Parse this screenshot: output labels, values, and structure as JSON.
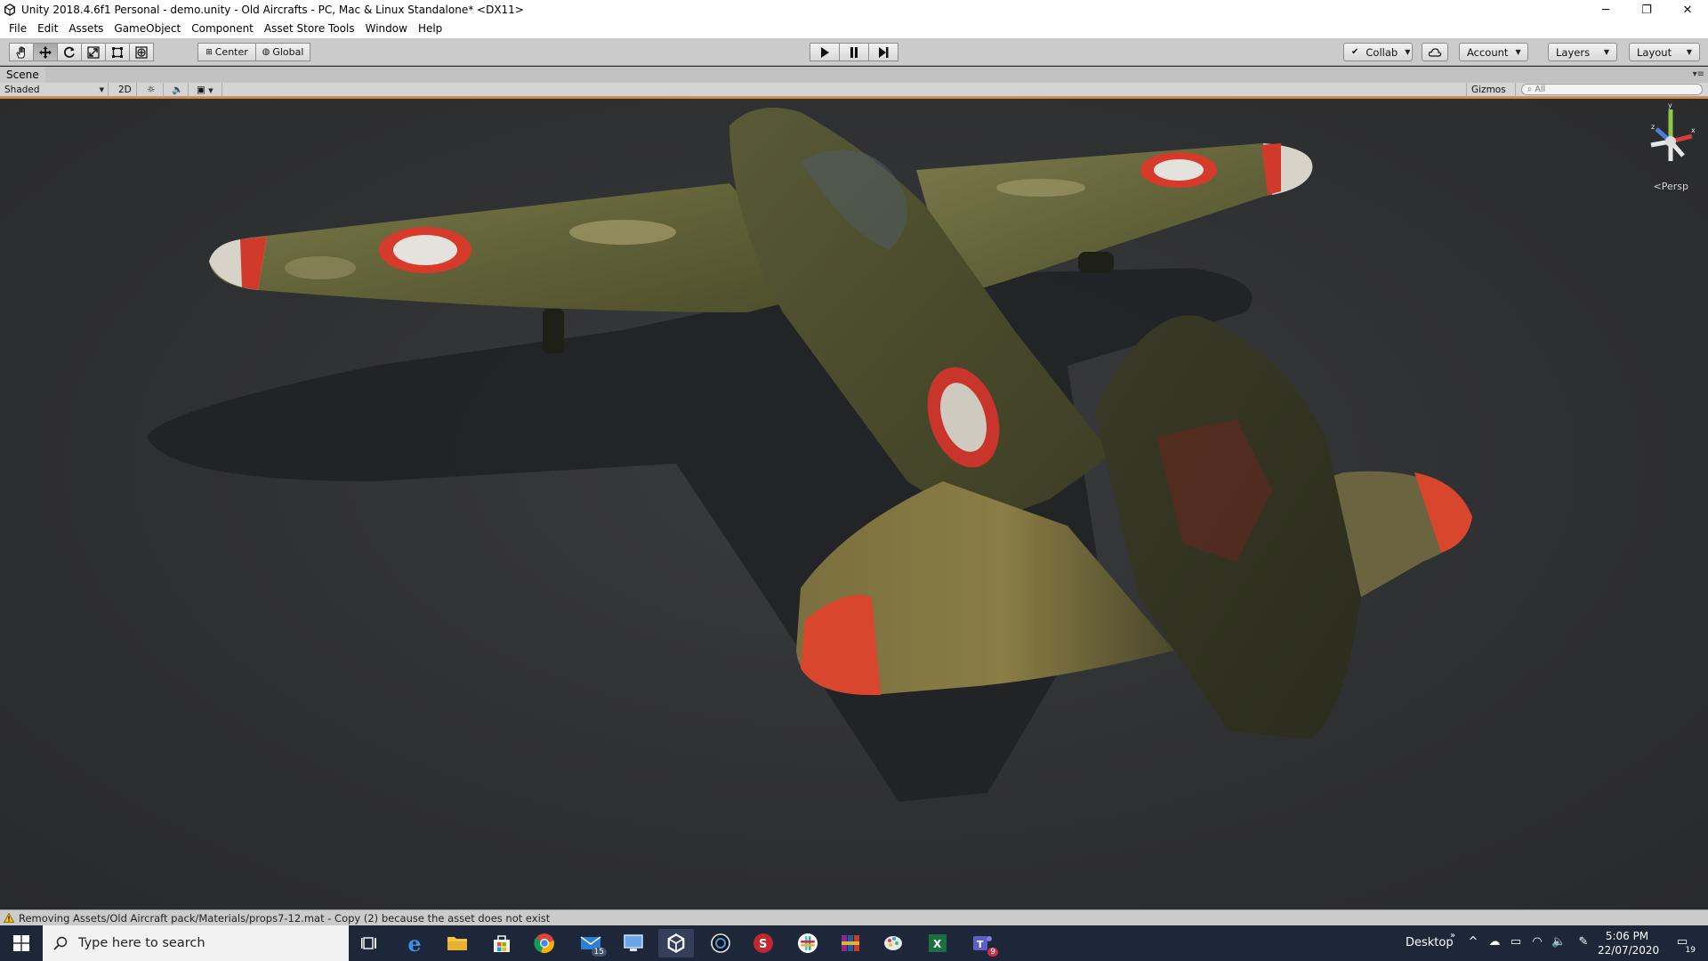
{
  "window": {
    "title": "Unity 2018.4.6f1 Personal - demo.unity - Old Aircrafts - PC, Mac & Linux Standalone* <DX11>",
    "controls": {
      "minimize": "─",
      "restore": "❐",
      "close": "✕"
    }
  },
  "menu": [
    "File",
    "Edit",
    "Assets",
    "GameObject",
    "Component",
    "Asset Store Tools",
    "Window",
    "Help"
  ],
  "toolbar": {
    "transform_tools": [
      {
        "name": "hand-tool",
        "icon": "hand-icon"
      },
      {
        "name": "move-tool",
        "icon": "move-icon"
      },
      {
        "name": "rotate-tool",
        "icon": "rotate-icon"
      },
      {
        "name": "scale-tool",
        "icon": "scale-icon"
      },
      {
        "name": "rect-tool",
        "icon": "rect-icon"
      },
      {
        "name": "transform-tool",
        "icon": "transform-icon"
      }
    ],
    "pivot_label": "Center",
    "space_label": "Global",
    "collab_label": "Collab",
    "account_label": "Account",
    "layers_label": "Layers",
    "layout_label": "Layout"
  },
  "scene": {
    "tab_label": "Scene",
    "shading_mode": "Shaded",
    "mode_2d": "2D",
    "gizmos_label": "Gizmos",
    "search_placeholder": "All",
    "persp_label": "Persp",
    "gizmo_axes": {
      "y": "y",
      "z": "z",
      "x": "x"
    }
  },
  "status": {
    "message": "Removing Assets/Old Aircraft pack/Materials/props7-12.mat - Copy (2) because the asset does not exist"
  },
  "taskbar": {
    "search_placeholder": "Type here to search",
    "mail_badge": "15",
    "teams_badge": "9",
    "desktop_label": "Desktop",
    "time": "5:06 PM",
    "date": "22/07/2020",
    "notification_count": "19"
  },
  "colors": {
    "accent_orange": "#e8822d",
    "taskbar_bg": "#1d2739",
    "toolbar_bg": "#cbcbcb",
    "viewport_bg": "#2f3032"
  }
}
